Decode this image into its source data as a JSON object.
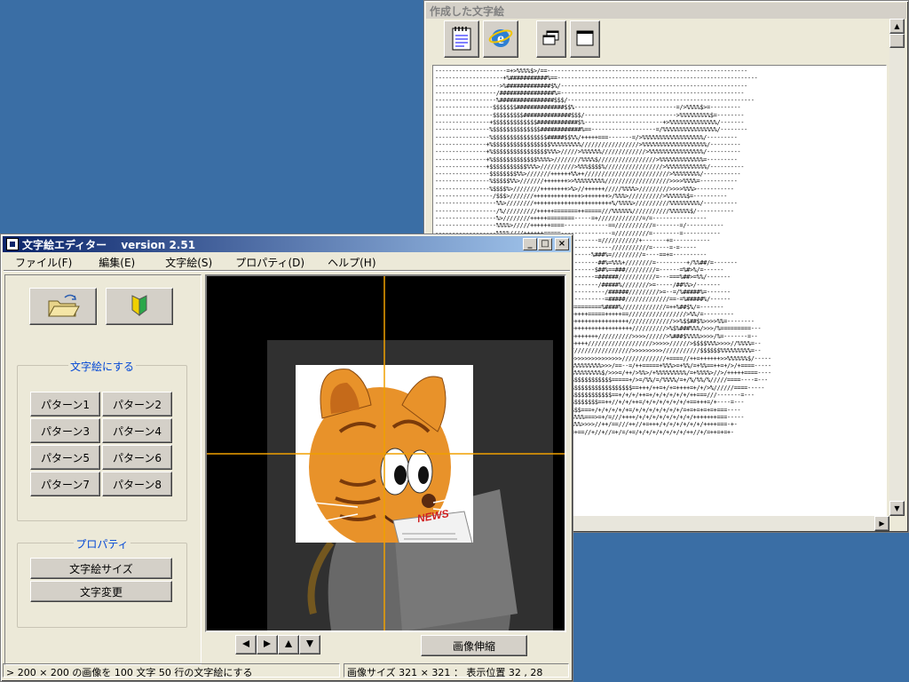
{
  "ascii_window": {
    "title": "作成した文字絵",
    "ascii_text": "---------------------=+>%%%%$>/==-----------------------------------------------------------\n--------------------+%###########%==-----------------------------------------------------------\n------------------->%#############$%/-------------------------------------------------------\n------------------/################%=------------------------------------------------------\n------------------%################$$$/-------------------------------------------------------\n-----------------$$$$$$$##############$$%------------------------------=/>%%%%$>=---------\n-----------------$$$$$$$$$##############$$$/--------------------------->%%%%%%%%%$=--------\n----------------+$$$$$$$$$$$$$############$%-----------------------+>%%%%%%%%%%%%%%/-------\n----------------%$$$$$$$$$$$$$$############%==-------------------=/%%%%%%%%%%%%%%%%/--------\n----------------%$$$$$$$$$$$$$$$$#####$$%%/+++++===-------=/>%%%%%%%%%%%%%%%%%%/---------\n---------------+%$$$$$$$$$$$$$$$$$%%%%%%%%%/////////////////>%%%%%%%%%%%%%%%%%%%/---------\n---------------+%$$$$$$$$$$$$$$$$%%%>/////>%%%%%%/////////////>%%%%%%%%%%%%%%%%/----------\n---------------+%$$$$$$$$$$$$$%%%%>////////%%%%$/////////////////>%%%%%%%%%%%%%=---------\n---------------+$$$$$$$$$$$%%%>//////////>%%%$$$$%/////////////////>%%%%%%%%%%%%/----------\n----------------$$$$$$$$%%>///////++++++%%++/////////////////////////>%%%%%%%%/-----------\n----------------%$$$$$%%>///////+++++++>>%%%%%%%%%///////////////////>>>>%%%%=-----------\n----------------%$$$$%>////////++++++++>%>//++++++/////%%%%>/////////>>>>%%%>-----------\n-----------------/$$$>///////++++++++++++++>+++++++>/%%%>//////////>%%%%%%$=----------\n------------------%%>////////+++++++++++++++++++++++%/%%%%>//////////%%%%%%%%%/----------\n------------------/%//////////+++++=======++=====///%%%%%%///////////%%%%%%$/-----------\n------------------%>////////+++++========-----=+/////////////=/=----------------\n------------------%%%%>/////++++++====-------------==///////////=-------=/-----------\n------------------%%%%////++++++=====---------------=//////////=--------=-----------\n------------------>%%//+++++++++===-------------=///////////+-------+=-----------\n-----------------/%%%%//+++++++===------------------///////////=-----=-=-----\n-----------------%%%%%////+++++===------------%###%=/////////=----==+=----------\n-----------------%%%%%%%//++++++===-------------##%=%%%+////////=---------+/%%##/=-------\n-----------------%%%%%%>////++++++===----------$##%==###/////////=------=%#>%/=------\n-----------------%%%%%%//////++++====----------=######///////////=---===%##>=%%/-------\n-----------------%%%%%%//////++=+=====----------/#####%////////>=-----/##%%>/-------\n-----------------%%%%%%/////////==----------------/######/////////>=--=/%#####%=-------\n-----------------%%%%%%%/////////+++++=-----------=#####/////////////==-=%#####%/------\n-----------------%%%%%%%%/////////=+++++=========%####%/////////////=++%##$%/=-------\n-----------------%%%%%%%%%%//////////++++++++=====+++++==/////////////////>%%/=---------\n-----------------%%%%%%%%%//////////+++++++++++++++++++++/////////////>>%$$##$%>>>>%%=--------\n-----------------%%%%%%%%%%%%%%///////++++++++++++++++++++//////////>%$%###%%%/>>>/%=========---\n-----------------%%%%%%%%%%%%%%%///////+++++++++//////////>>>>//////>%###$%%%%>>>>/%=-------=--\n-----------------%%%%%%%%%%%%%%%%//////++++++///////////////////>>>>>//////>$$$$%%%>>>>//%%%%=--\n-----------------%%%%%%%%%%%%%%%%%%%%/////////////////////>>>>>>>>>///////////$$$$$$%%%%%%%%%=--\n-----------------%%%%%%%%%%%%%%%%%%%%%%>>>>>>>>>>>>>>>>/////////////+====//++=++++++>>%%%%%%$/-----\n-----------------%%%%%%%%%%%%%%%%%%%%%%%%%%%%%%%%>>>/==--=/++=====+%%%>=+%%/=+%%==++=+/>/+====-----\n-----------------%%%%%%%%%%%%%%%%%%%%%%%%%%%%%%%%$/>>>=/++/>%%>/+%%%%%%%%%/=+%%%%>//>/+++++====----\n-----------------/>>%%%%%%%%%%%%%%$$$$$$$$$$$$$$$$$$=====+/>=/%%/=/%%%%/=+/%/%%/%/////====----=---\n------------------/%/%%%$$$$$$$$$$$$$$$$$$$$$$$$$$$$$$$$$$==+++/++=+/+=++++=+/+/>%//////====-----\n------------------%%%%$$$$$$$$$$$$$$$$$$$$$$$$$$$$$$==+/+/+/++=+/+/+/+/+/+/++===///-------=---\n------------------/%%%$$$$$$$$$$$$$$$$$$$$$$$$$$==++//+/+/++=/+/+/+/+/+/+/+==+++=/+----=---\n------------------%%%$$$$$$$$$$$$$$$$$$$$$$===+/+/+/+/+/+=/+/+/+/+/+/+/+/=+=+=+=+=+===----\n------------------+%%%%%%%%%%%%%%%%%>>>$$%%%===>=+/=///++++/+/+/+/+/+/+/+/+/+++++++===-----\n------------------+/>%%%%%%%%%%%%%%%%%%%%%%>>>>//++/==///++//+=+++/+/+/+/+/+/+/++++===-+-\n------------------=+/%%%%%%%%%$$$$$$/=//=+==//+//+//=+/=/+=/+/+/+/+/+/+/+/++//+/=++=+=+-"
  },
  "editor_window": {
    "title": "文字絵エディター　 version 2.51",
    "menu": [
      "ファイル(F)",
      "編集(E)",
      "文字絵(S)",
      "プロパティ(D)",
      "ヘルプ(H)"
    ],
    "group_convert_label": "文字絵にする",
    "patterns": [
      "パターン1",
      "パターン2",
      "パターン3",
      "パターン4",
      "パターン5",
      "パターン6",
      "パターン7",
      "パターン8"
    ],
    "group_property_label": "プロパティ",
    "property_buttons": [
      "文字絵サイズ",
      "文字変更"
    ],
    "resize_button": "画像伸縮",
    "status_left": "> 200 × 200 の画像を 100 文字 50 行の文字絵にする",
    "status_right": "画像サイズ 321 × 321 ： 表示位置 32 , 28",
    "news_label": "NEWS"
  },
  "colors": {
    "desktop": "#3a6ea5",
    "crosshair": "#f0a000",
    "cat_orange": "#e8922a"
  }
}
